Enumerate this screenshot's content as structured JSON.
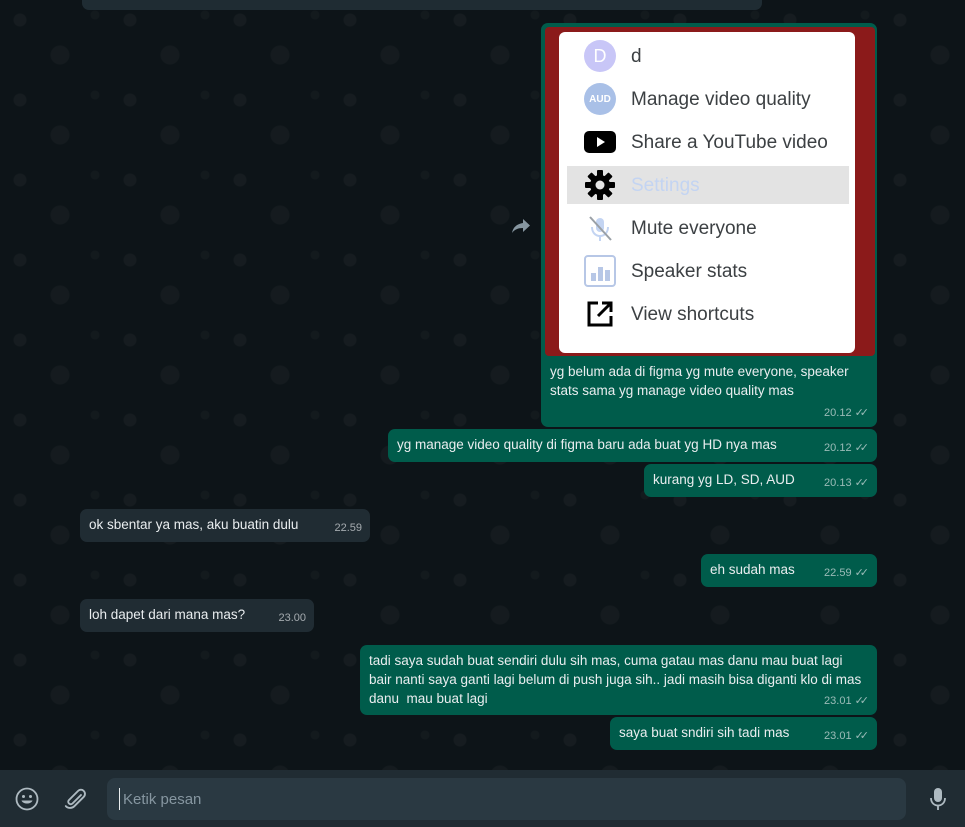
{
  "chat": {
    "image_message": {
      "menu": {
        "items": [
          {
            "icon": "avatar-d-icon",
            "avatar_letter": "D",
            "label": "d"
          },
          {
            "icon": "avatar-aud-icon",
            "avatar_letter": "AUD",
            "label": "Manage video quality"
          },
          {
            "icon": "youtube-icon",
            "label": "Share a YouTube video"
          },
          {
            "icon": "gear-icon",
            "label": "Settings"
          },
          {
            "icon": "mic-off-icon",
            "label": "Mute everyone"
          },
          {
            "icon": "bar-chart-icon",
            "label": "Speaker stats"
          },
          {
            "icon": "external-link-icon",
            "label": "View shortcuts"
          }
        ]
      },
      "caption": "yg belum ada di figma yg mute everyone, speaker stats sama yg manage video quality mas",
      "time": "20.12"
    },
    "messages": [
      {
        "dir": "out",
        "text": "yg manage video quality di figma baru ada buat yg HD nya mas",
        "time": "20.12"
      },
      {
        "dir": "out",
        "text": "kurang yg LD, SD, AUD",
        "time": "20.13"
      },
      {
        "dir": "in",
        "text": "ok sbentar ya mas, aku buatin dulu",
        "time": "22.59"
      },
      {
        "dir": "out",
        "text": "eh sudah mas",
        "time": "22.59"
      },
      {
        "dir": "in",
        "text": "loh dapet dari mana mas?",
        "time": "23.00"
      },
      {
        "dir": "out",
        "text": "tadi saya sudah buat sendiri dulu sih mas, cuma gatau mas danu mau buat lagi bair nanti saya ganti lagi belum di push juga sih.. jadi masih bisa diganti klo di mas danu  mau buat lagi",
        "time": "23.01"
      },
      {
        "dir": "out",
        "text": "saya buat sndiri sih tadi mas",
        "time": "23.01"
      }
    ]
  },
  "composer": {
    "placeholder": "Ketik pesan",
    "value": ""
  },
  "colors": {
    "outgoing_bubble": "#005c4b",
    "incoming_bubble": "#202c33",
    "background": "#0b141a",
    "image_border": "#8b1a1a"
  }
}
